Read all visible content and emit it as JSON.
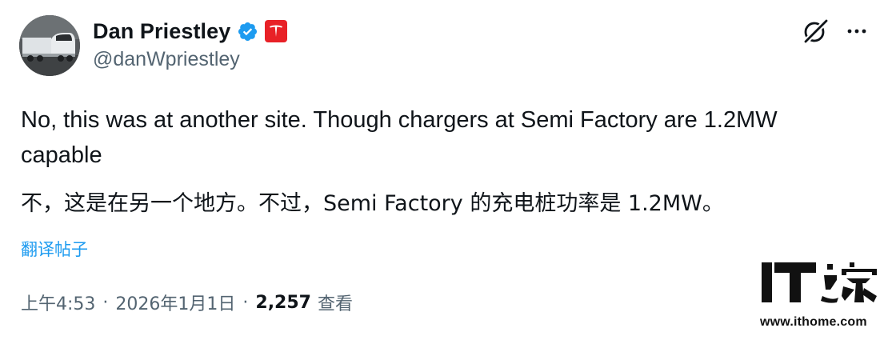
{
  "author": {
    "display_name": "Dan Priestley",
    "handle": "@danWpriestley",
    "verified_icon": "verified-badge-icon",
    "affiliation_icon": "tesla-logo-icon",
    "avatar": "semi-truck-photo"
  },
  "actions": {
    "grok_icon": "grok-icon",
    "more_icon": "more-options-icon"
  },
  "tweet": {
    "text_en": "No, this was at another site. Though chargers at Semi Factory are 1.2MW capable",
    "text_zh": "不，这是在另一个地方。不过，Semi Factory 的充电桩功率是 1.2MW。",
    "translate_label": "翻译帖子"
  },
  "meta": {
    "time": "上午4:53",
    "separator": "·",
    "date": "2026年1月1日",
    "views_count": "2,257",
    "views_label": "查看"
  },
  "watermark": {
    "logo_text": "IT之家",
    "url": "www.ithome.com"
  },
  "colors": {
    "text_primary": "#0f1419",
    "text_secondary": "#536471",
    "link": "#1d9bf0",
    "verified": "#1d9bf0",
    "tesla_red": "#e82127"
  }
}
